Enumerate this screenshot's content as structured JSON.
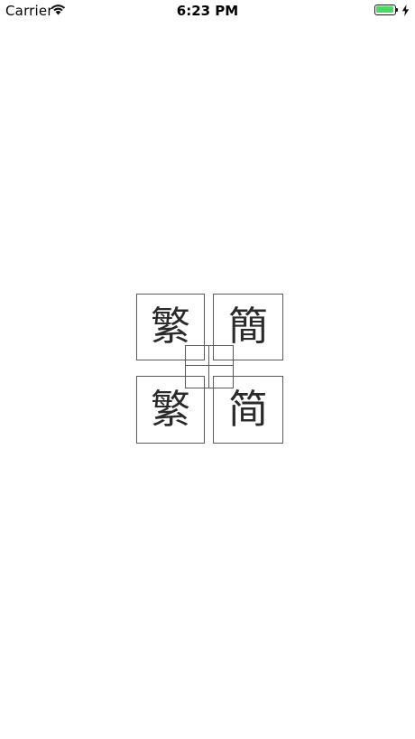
{
  "status_bar": {
    "carrier": "Carrier",
    "wifi_icon": "wifi-icon",
    "time": "6:23 PM",
    "battery_icon": "battery-icon",
    "battery_level": 1.0,
    "charging_icon": "bolt-icon",
    "battery_color": "#4cd964"
  },
  "logo": {
    "top_left": "繁",
    "top_right": "簡",
    "bottom_left": "繁",
    "bottom_right": "简"
  }
}
